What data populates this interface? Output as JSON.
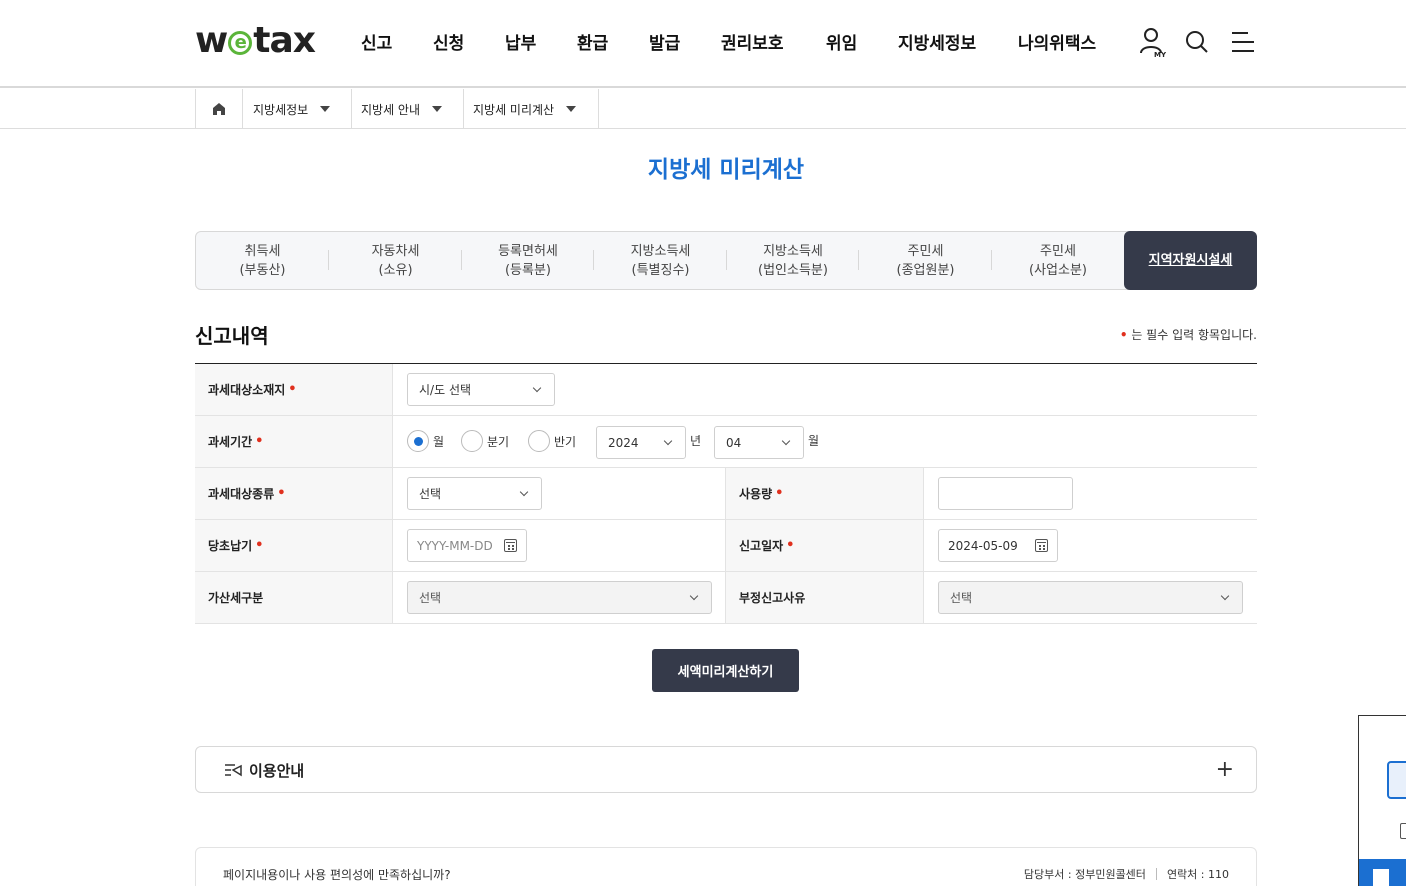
{
  "header": {
    "logo_prefix": "w",
    "logo_e": "e",
    "logo_suffix": "tax",
    "nav": [
      "신고",
      "신청",
      "납부",
      "환급",
      "발급",
      "권리보호",
      "위임",
      "지방세정보",
      "나의위택스"
    ],
    "my_label": "MY"
  },
  "breadcrumb": [
    "지방세정보",
    "지방세 안내",
    "지방세 미리계산"
  ],
  "page_title": "지방세 미리계산",
  "tabs": [
    {
      "line1": "취득세",
      "line2": "(부동산)"
    },
    {
      "line1": "자동차세",
      "line2": "(소유)"
    },
    {
      "line1": "등록면허세",
      "line2": "(등록분)"
    },
    {
      "line1": "지방소득세",
      "line2": "(특별징수)"
    },
    {
      "line1": "지방소득세",
      "line2": "(법인소득분)"
    },
    {
      "line1": "주민세",
      "line2": "(종업원분)"
    },
    {
      "line1": "주민세",
      "line2": "(사업소분)"
    },
    {
      "line1": "지역자원시설세",
      "line2": ""
    }
  ],
  "section_title": "신고내역",
  "required_note": "는 필수 입력 항목입니다.",
  "required_mark": "•",
  "form": {
    "location_label": "과세대상소재지",
    "location_select": "시/도 선택",
    "period_label": "과세기간",
    "radio_month": "월",
    "radio_quarter": "분기",
    "radio_half": "반기",
    "year_value": "2024",
    "year_unit": "년",
    "month_value": "04",
    "month_unit": "월",
    "type_label": "과세대상종류",
    "type_select": "선택",
    "usage_label": "사용량",
    "usage_value": "",
    "due_label": "당초납기",
    "due_placeholder": "YYYY-MM-DD",
    "report_date_label": "신고일자",
    "report_date_value": "2024-05-09",
    "penalty_label": "가산세구분",
    "penalty_select": "선택",
    "reason_label": "부정신고사유",
    "reason_select": "선택"
  },
  "calc_button": "세액미리계산하기",
  "guide_label": "이용안내",
  "guide_toggle": "+",
  "survey": {
    "question": "페이지내용이나 사용 편의성에 만족하십니까?",
    "dept": "담당부서 : 정부민원콜센터",
    "contact": "연락처 : 110"
  },
  "colors": {
    "accent": "#1b6fd1",
    "dark": "#353a4a",
    "required": "#e0301e",
    "logo_green": "#5bb53a"
  }
}
